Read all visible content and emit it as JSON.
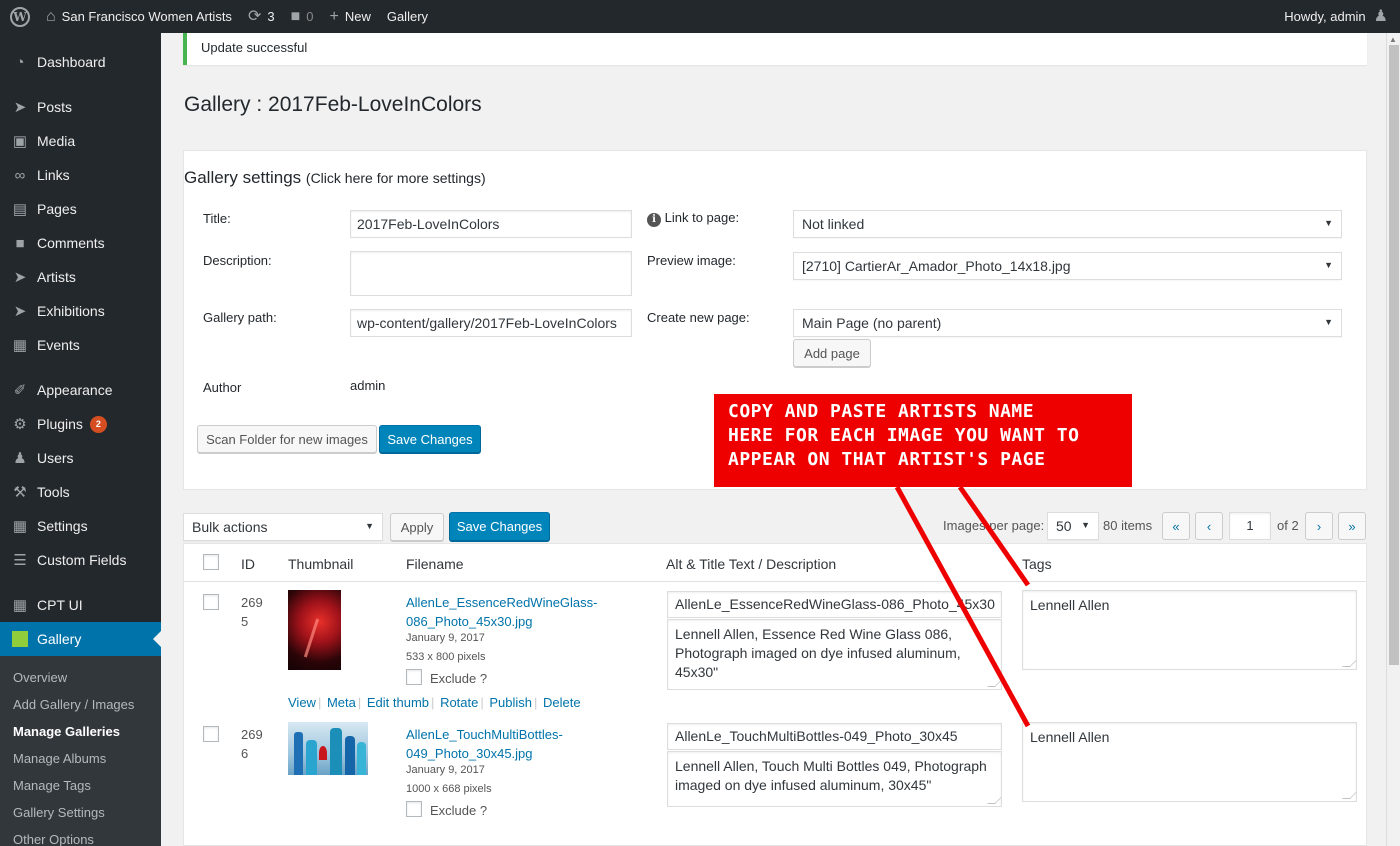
{
  "admin_bar": {
    "site_name": "San Francisco Women Artists",
    "updates_count": "3",
    "comments_count": "0",
    "new_label": "New",
    "gallery_label": "Gallery",
    "howdy": "Howdy, admin"
  },
  "sidebar": {
    "items": [
      {
        "label": "Dashboard",
        "icon": "dashboard-icon"
      },
      {
        "label": "Posts",
        "icon": "pin-icon"
      },
      {
        "label": "Media",
        "icon": "media-icon"
      },
      {
        "label": "Links",
        "icon": "link-icon"
      },
      {
        "label": "Pages",
        "icon": "page-icon"
      },
      {
        "label": "Comments",
        "icon": "comment-icon"
      },
      {
        "label": "Artists",
        "icon": "pin-icon"
      },
      {
        "label": "Exhibitions",
        "icon": "pin-icon"
      },
      {
        "label": "Events",
        "icon": "calendar-icon"
      },
      {
        "label": "Appearance",
        "icon": "brush-icon"
      },
      {
        "label": "Plugins",
        "icon": "plugin-icon",
        "badge": "2"
      },
      {
        "label": "Users",
        "icon": "user-icon"
      },
      {
        "label": "Tools",
        "icon": "wrench-icon"
      },
      {
        "label": "Settings",
        "icon": "settings-icon"
      },
      {
        "label": "Custom Fields",
        "icon": "fields-icon"
      },
      {
        "label": "CPT UI",
        "icon": "grid-icon"
      },
      {
        "label": "Gallery",
        "icon": "gallery-icon"
      }
    ],
    "submenu": [
      "Overview",
      "Add Gallery / Images",
      "Manage Galleries",
      "Manage Albums",
      "Manage Tags",
      "Gallery Settings",
      "Other Options"
    ],
    "current_submenu": "Manage Galleries"
  },
  "notice": "Update successful",
  "page_title": "Gallery : 2017Feb-LoveInColors",
  "settings": {
    "heading": "Gallery settings",
    "heading_link": "(Click here for more settings)",
    "title_label": "Title:",
    "title_value": "2017Feb-LoveInColors",
    "description_label": "Description:",
    "description_value": "",
    "path_label": "Gallery path:",
    "path_value": "wp-content/gallery/2017Feb-LoveInColors",
    "author_label": "Author",
    "author_value": "admin",
    "link_label": "Link to page:",
    "link_value": "Not linked",
    "preview_label": "Preview image:",
    "preview_value": "[2710] CartierAr_Amador_Photo_14x18.jpg",
    "newpage_label": "Create new page:",
    "newpage_value": "Main Page (no parent)",
    "add_page": "Add page",
    "scan_folder": "Scan Folder for new images",
    "save_changes": "Save Changes"
  },
  "tablenav": {
    "bulk_actions": "Bulk actions",
    "apply": "Apply",
    "save_changes": "Save Changes",
    "images_per_page_label": "Images per page:",
    "per_page_value": "50",
    "items_count": "80 items",
    "first": "«",
    "prev": "‹",
    "current_page": "1",
    "of_pages": "of 2",
    "next": "›",
    "last": "»"
  },
  "table": {
    "headers": {
      "id": "ID",
      "thumbnail": "Thumbnail",
      "filename": "Filename",
      "alt": "Alt & Title Text / Description",
      "tags": "Tags"
    },
    "row_actions": [
      "View",
      "Meta",
      "Edit thumb",
      "Rotate",
      "Publish",
      "Delete"
    ],
    "rows": [
      {
        "id_line1": "269",
        "id_line2": "5",
        "filename_line1": "AllenLe_EssenceRedWineGlass-",
        "filename_line2": "086_Photo_45x30.jpg",
        "date": "January 9, 2017",
        "dimensions": "533 x 800 pixels",
        "exclude": "Exclude ?",
        "alt": "AllenLe_EssenceRedWineGlass-086_Photo_45x30",
        "description": "Lennell Allen, Essence Red Wine Glass 086,\nPhotograph imaged on dye infused aluminum,\n45x30\"",
        "tags": "Lennell Allen"
      },
      {
        "id_line1": "269",
        "id_line2": "6",
        "filename_line1": "AllenLe_TouchMultiBottles-",
        "filename_line2": "049_Photo_30x45.jpg",
        "date": "January 9, 2017",
        "dimensions": "1000 x 668 pixels",
        "exclude": "Exclude ?",
        "alt": "AllenLe_TouchMultiBottles-049_Photo_30x45",
        "description": "Lennell Allen, Touch Multi Bottles 049, Photograph\nimaged on dye infused aluminum, 30x45\"",
        "tags": "Lennell Allen"
      }
    ]
  },
  "callout": {
    "line1": "COPY AND PASTE ARTISTS NAME",
    "line2": "HERE FOR EACH IMAGE YOU WANT TO",
    "line3": "APPEAR ON THAT ARTIST'S PAGE",
    "color": "#ee0000"
  }
}
